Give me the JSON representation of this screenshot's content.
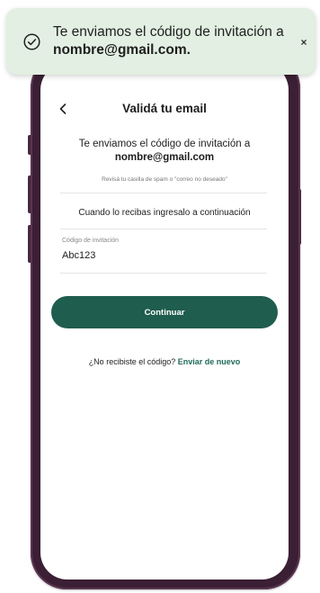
{
  "toast": {
    "icon": "check-circle-icon",
    "message_prefix": "Te enviamos el código de invitación a ",
    "email": "nombre@gmail.com.",
    "close_icon": "close-icon",
    "close_glyph": "×"
  },
  "header": {
    "back_icon": "chevron-left-icon",
    "back_glyph": "<",
    "title": "Validá tu email"
  },
  "main": {
    "sent_line1": "Te enviamos el código de invitación a",
    "sent_email": "nombre@gmail.com",
    "hint": "Revisá tu casilla de spam o \"correo no deseado\"",
    "instruction": "Cuando lo recibas ingresalo a continuación",
    "code_field": {
      "label": "Código de invitación",
      "value": "Abc123"
    },
    "continue_label": "Continuar",
    "resend_prompt": "¿No recibiste el código?",
    "resend_link": "Enviar de nuevo"
  },
  "colors": {
    "primary": "#1f5d4e",
    "toast_bg": "#e2efe2",
    "phone_frame": "#3b1f34"
  }
}
